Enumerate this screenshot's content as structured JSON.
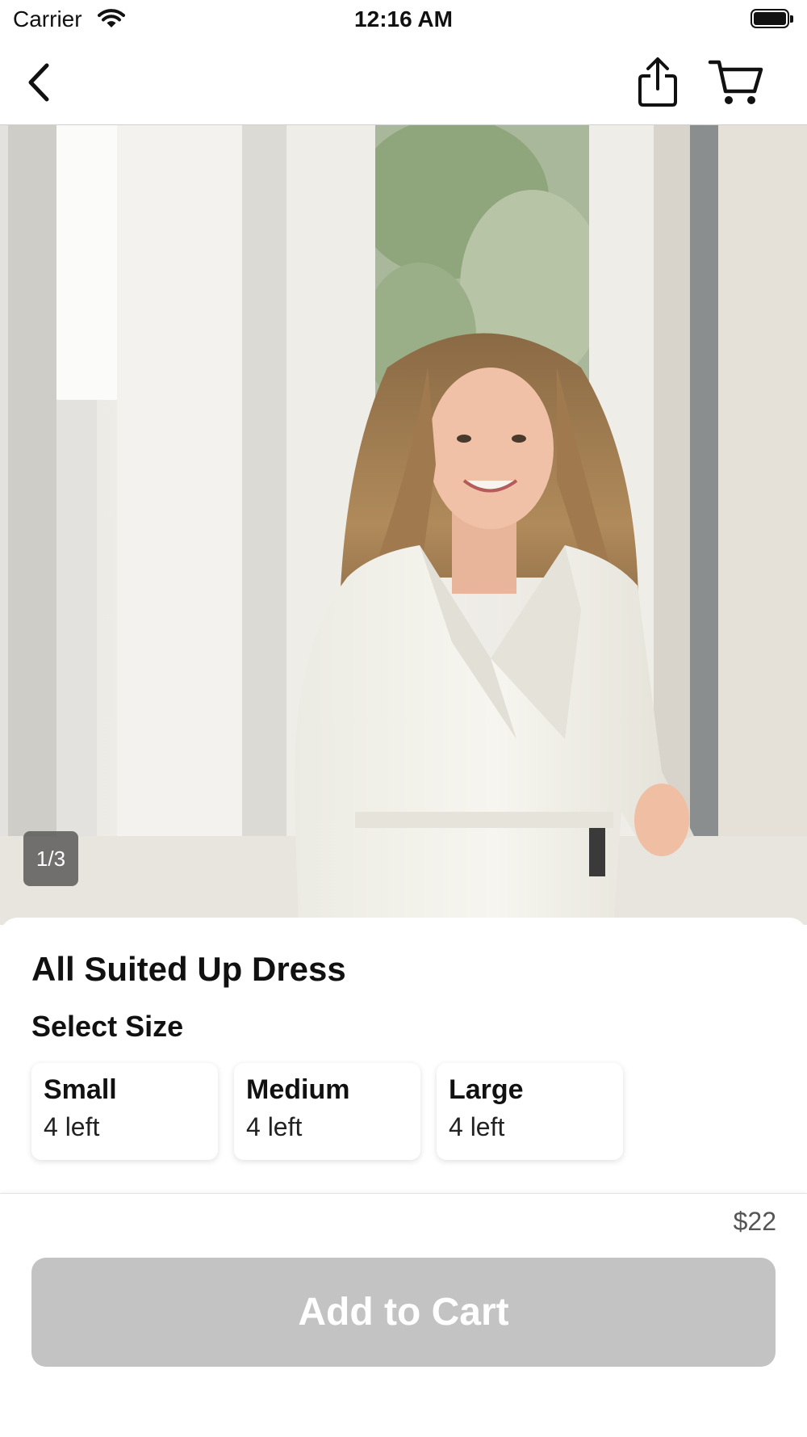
{
  "status_bar": {
    "carrier": "Carrier",
    "time": "12:16 AM",
    "wifi_icon": "wifi-icon",
    "battery_icon": "battery-full-icon"
  },
  "nav": {
    "back_icon": "chevron-left-icon",
    "share_icon": "share-icon",
    "cart_icon": "cart-icon"
  },
  "gallery": {
    "page_indicator": "1/3",
    "current_page": 1,
    "total_pages": 3
  },
  "product": {
    "title": "All Suited Up Dress",
    "select_size_label": "Select Size",
    "sizes": [
      {
        "name": "Small",
        "stock": "4 left"
      },
      {
        "name": "Medium",
        "stock": "4 left"
      },
      {
        "name": "Large",
        "stock": "4 left"
      }
    ],
    "price": "$22"
  },
  "footer": {
    "add_to_cart_label": "Add to Cart",
    "add_to_cart_enabled": false
  },
  "colors": {
    "button_disabled": "#c3c3c3",
    "text_primary": "#111111",
    "price_text": "#555555"
  }
}
